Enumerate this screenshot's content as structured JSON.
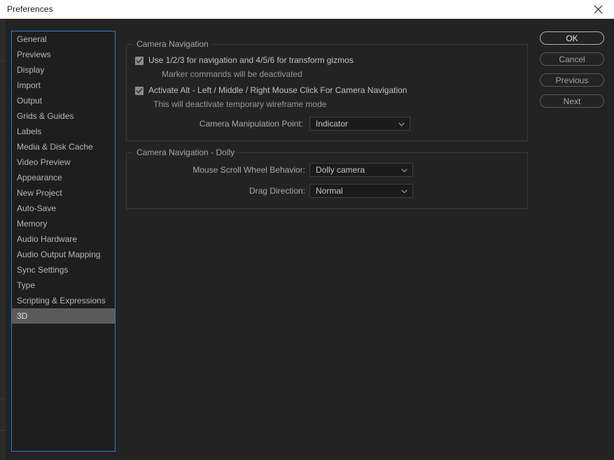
{
  "window": {
    "title": "Preferences",
    "close_icon": "close-icon",
    "accent_focus_color": "#2d7fd3",
    "background_color": "#232323"
  },
  "sidebar": {
    "selected": "3D",
    "items": [
      {
        "label": "General"
      },
      {
        "label": "Previews"
      },
      {
        "label": "Display"
      },
      {
        "label": "Import"
      },
      {
        "label": "Output"
      },
      {
        "label": "Grids & Guides"
      },
      {
        "label": "Labels"
      },
      {
        "label": "Media & Disk Cache"
      },
      {
        "label": "Video Preview"
      },
      {
        "label": "Appearance"
      },
      {
        "label": "New Project"
      },
      {
        "label": "Auto-Save"
      },
      {
        "label": "Memory"
      },
      {
        "label": "Audio Hardware"
      },
      {
        "label": "Audio Output Mapping"
      },
      {
        "label": "Sync Settings"
      },
      {
        "label": "Type"
      },
      {
        "label": "Scripting & Expressions"
      },
      {
        "label": "3D"
      }
    ]
  },
  "camera_navigation": {
    "title": "Camera Navigation",
    "checkbox_1": {
      "label": "Use 1/2/3 for navigation and 4/5/6 for transform gizmos",
      "checked": true,
      "note": "Marker commands will be deactivated"
    },
    "checkbox_2": {
      "label": "Activate Alt - Left / Middle / Right Mouse Click For Camera Navigation",
      "checked": true,
      "note": "This will deactivate temporary wireframe mode"
    },
    "manipulation_point": {
      "label": "Camera Manipulation Point:",
      "value": "Indicator",
      "arrow_icon": "chevron-down-icon"
    }
  },
  "camera_navigation_dolly": {
    "title": "Camera Navigation - Dolly",
    "scroll_wheel": {
      "label": "Mouse Scroll Wheel Behavior:",
      "value": "Dolly camera",
      "arrow_icon": "chevron-down-icon"
    },
    "drag_direction": {
      "label": "Drag Direction:",
      "value": "Normal",
      "arrow_icon": "chevron-down-icon"
    }
  },
  "buttons": {
    "ok": "OK",
    "cancel": "Cancel",
    "previous": "Previous",
    "next": "Next"
  }
}
